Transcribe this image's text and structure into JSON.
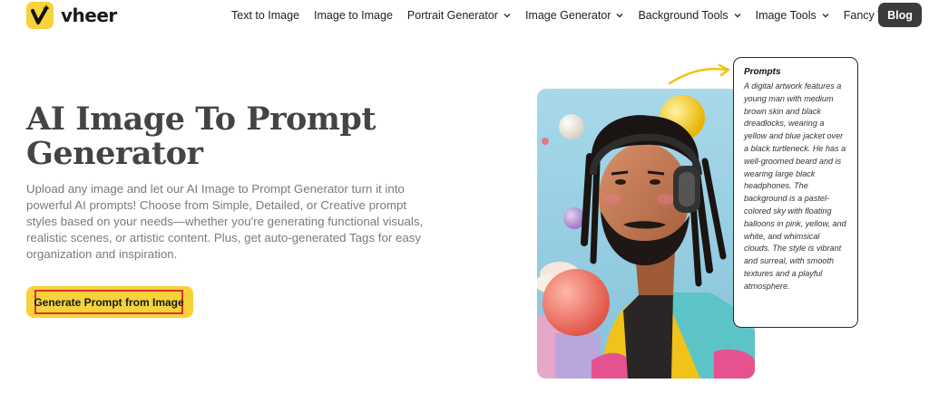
{
  "brand": {
    "name": "vheer",
    "logo_icon": "v-sparkle-logo",
    "accent": "#f7d23a"
  },
  "nav": {
    "items": [
      {
        "label": "Text to Image",
        "dropdown": false
      },
      {
        "label": "Image to Image",
        "dropdown": false
      },
      {
        "label": "Portrait Generator",
        "dropdown": true
      },
      {
        "label": "Image Generator",
        "dropdown": true
      },
      {
        "label": "Background Tools",
        "dropdown": true
      },
      {
        "label": "Image Tools",
        "dropdown": true
      },
      {
        "label": "Fancy Text",
        "dropdown": true
      }
    ],
    "blog_label": "Blog"
  },
  "hero": {
    "title": "AI Image To Prompt Generator",
    "description": "Upload any image and let our AI Image to Prompt Generator turn it into powerful AI prompts! Choose from Simple, Detailed, or Creative prompt styles based on your needs—whether you're generating functional visuals, realistic scenes, or artistic content. Plus, get auto-generated Tags for easy organization and inspiration.",
    "cta_label": "Generate Prompt from Image"
  },
  "prompt_card": {
    "title": "Prompts",
    "body": "A digital artwork features a young man with medium brown skin and black dreadlocks, wearing a yellow and blue jacket over a black turtleneck. He has a well-groomed beard and is wearing large black headphones. The background is a pastel-colored sky with floating balloons in pink, yellow, and white, and whimsical clouds. The style is vibrant and surreal, with smooth textures and a playful atmosphere."
  },
  "colors": {
    "cta_border": "#d9342b",
    "blog_bg": "#3b3b3b",
    "title": "#444444",
    "desc": "#7a7a7a"
  }
}
